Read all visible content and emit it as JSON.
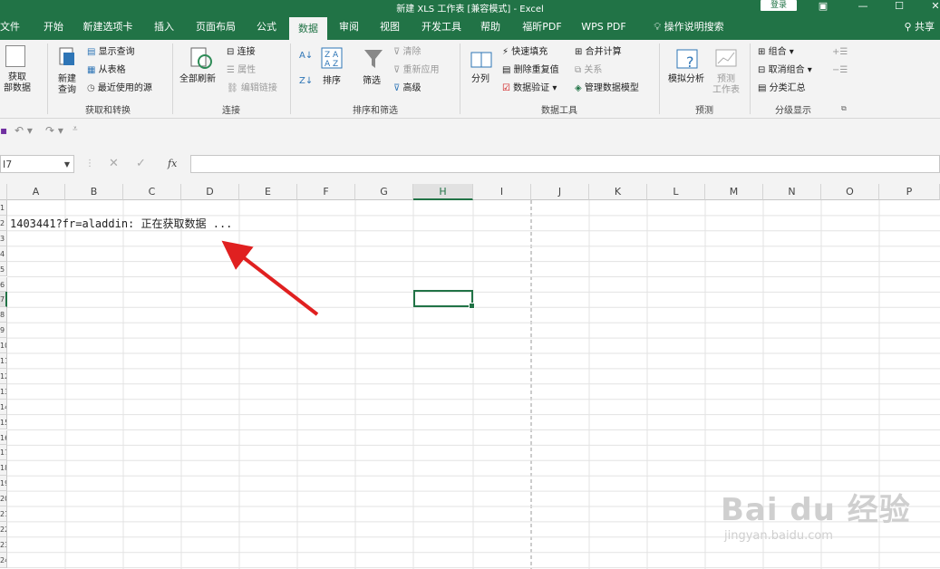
{
  "window": {
    "title": "新建 XLS 工作表 [兼容模式] - Excel",
    "login": "登录"
  },
  "tabs": [
    "文件",
    "开始",
    "新建选项卡",
    "插入",
    "页面布局",
    "公式",
    "数据",
    "审阅",
    "视图",
    "开发工具",
    "帮助",
    "福昕PDF",
    "WPS PDF"
  ],
  "tell_me": "操作说明搜索",
  "share": "共享",
  "ribbon": {
    "get_data": "获取\n部数据",
    "new_query": "新建\n查询",
    "show_query": "显示查询",
    "from_table": "从表格",
    "recent_sources": "最近使用的源",
    "group_get_transform": "获取和转换",
    "refresh_all": "全部刷新",
    "connections": "连接",
    "properties": "属性",
    "edit_links": "编辑链接",
    "group_connections": "连接",
    "sort": "排序",
    "filter": "筛选",
    "clear": "清除",
    "reapply": "重新应用",
    "advanced": "高级",
    "group_sort_filter": "排序和筛选",
    "text_to_columns": "分列",
    "flash_fill": "快速填充",
    "remove_duplicates": "删除重复值",
    "data_validation": "数据验证",
    "consolidate": "合并计算",
    "relationships": "关系",
    "manage_model": "管理数据模型",
    "group_data_tools": "数据工具",
    "what_if": "模拟分析",
    "forecast_sheet": "预测\n工作表",
    "group_forecast": "预测",
    "group": "组合",
    "ungroup": "取消组合",
    "subtotal": "分类汇总",
    "group_outline": "分级显示"
  },
  "formula_bar": {
    "name_box": "I7",
    "fx": "fx"
  },
  "columns": [
    "A",
    "B",
    "C",
    "D",
    "E",
    "F",
    "G",
    "H",
    "I",
    "J",
    "K",
    "L",
    "M",
    "N",
    "O",
    "P"
  ],
  "selected_column": "H",
  "row_numbers": [
    "1",
    "2",
    "3",
    "4",
    "5",
    "6",
    "7",
    "8",
    "9",
    "10",
    "11",
    "12",
    "13",
    "14",
    "15",
    "16",
    "17",
    "18",
    "19",
    "20",
    "21",
    "22",
    "23",
    "24"
  ],
  "cell_text": "1403441?fr=aladdin: 正在获取数据 ...",
  "watermark": {
    "brand": "Bai du 经验",
    "url": "jingyan.baidu.com"
  }
}
